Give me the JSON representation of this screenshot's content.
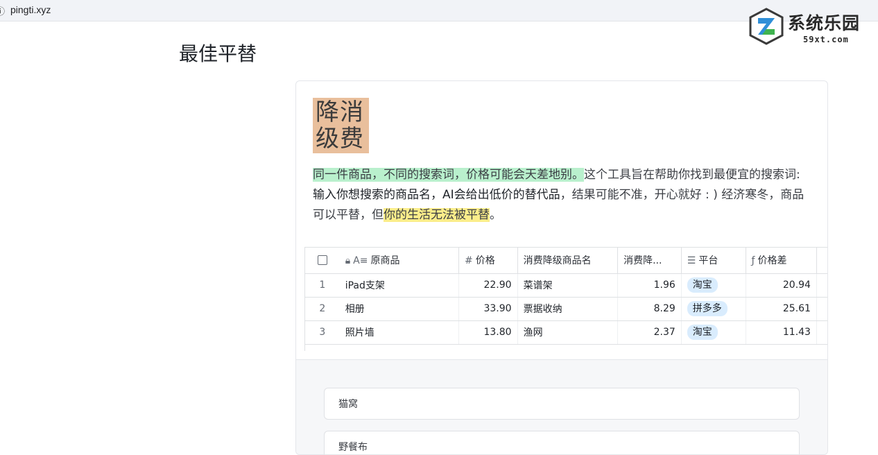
{
  "browser": {
    "url": "pingti.xyz"
  },
  "watermark": {
    "title": "系统乐园",
    "sub": "59xt.com"
  },
  "page": {
    "title": "最佳平替"
  },
  "card": {
    "badge_line1": "降消",
    "badge_line2": "级费",
    "intro": {
      "p1_highlight": "同一件商品，不同的搜索词，价格可能会天差地别。",
      "p2": "这个工具旨在帮助你找到最便宜的搜索词: ",
      "p3_strong": "输入你想搜索的商品名，AI会给出低价的替代品",
      "p4": "，结果可能不准，开心就好 : ) 经济寒冬，商品可以平替，但",
      "p5_highlight": "你的生活无法被平替",
      "p6": "。"
    }
  },
  "table": {
    "headers": {
      "original": "原商品",
      "price": "价格",
      "alt_name": "消费降级商品名",
      "alt_price": "消费降...",
      "platform": "平台",
      "diff": "价格差"
    },
    "rows": [
      {
        "idx": "1",
        "original": "iPad支架",
        "price": "22.90",
        "alt_name": "菜谱架",
        "alt_price": "1.96",
        "platform": "淘宝",
        "diff": "20.94"
      },
      {
        "idx": "2",
        "original": "相册",
        "price": "33.90",
        "alt_name": "票据收纳",
        "alt_price": "8.29",
        "platform": "拼多多",
        "diff": "25.61"
      },
      {
        "idx": "3",
        "original": "照片墙",
        "price": "13.80",
        "alt_name": "渔网",
        "alt_price": "2.37",
        "platform": "淘宝",
        "diff": "11.43"
      }
    ]
  },
  "form": {
    "field1_value": "猫窝",
    "field2_value": "野餐布"
  },
  "colors": {
    "badge_bg": "#e9bf9c",
    "green_highlight": "#b9f0cd",
    "yellow_highlight": "#fbed8a",
    "platform_tag": "#d9ecfd"
  }
}
